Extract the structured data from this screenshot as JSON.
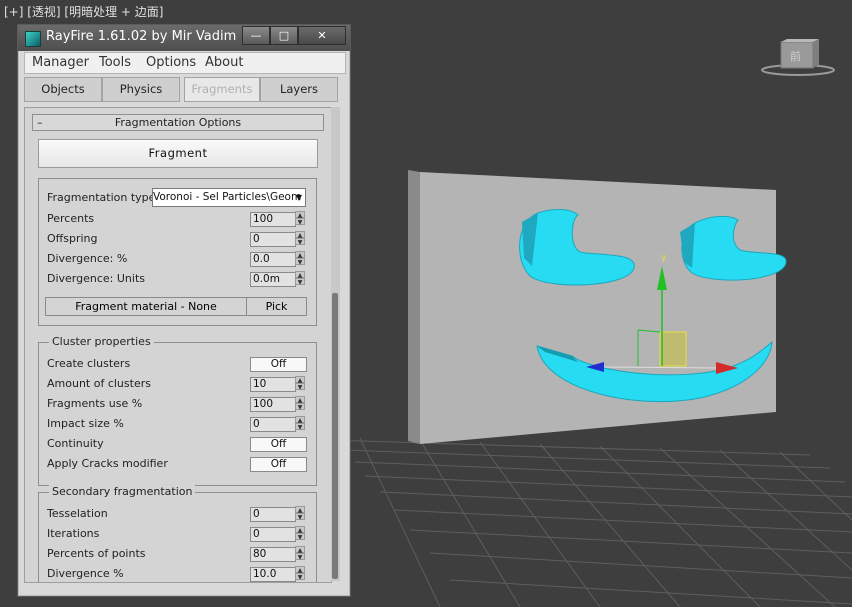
{
  "viewport": {
    "label": "[+] [透视] [明暗处理 + 边面]",
    "viewcube_label": "前"
  },
  "window": {
    "title": "RayFire 1.61.02  by Mir Vadim",
    "min_glyph": "—",
    "max_glyph": "□",
    "close_glyph": "✕"
  },
  "menu": [
    "Manager",
    "Tools",
    "Options",
    "About"
  ],
  "tabs": [
    {
      "label": "Objects",
      "active": false
    },
    {
      "label": "Physics",
      "active": false
    },
    {
      "label": "Fragments",
      "active": true
    },
    {
      "label": "Layers",
      "active": false
    }
  ],
  "rollout": {
    "minus": "–",
    "title": "Fragmentation Options",
    "fragment_button": "Fragment"
  },
  "frag_group": {
    "type_label": "Fragmentation type",
    "type_value": "Voronoi - Sel Particles\\Geom",
    "rows": [
      {
        "label": "Percents",
        "value": "100"
      },
      {
        "label": "Offspring",
        "value": "0"
      },
      {
        "label": "Divergence: %",
        "value": "0.0"
      },
      {
        "label": "Divergence: Units",
        "value": "0.0m"
      }
    ],
    "material_label": "Fragment material - None",
    "pick_label": "Pick"
  },
  "cluster_group": {
    "title": "Cluster properties",
    "create_label": "Create clusters",
    "create_value": "Off",
    "amount_label": "Amount of clusters",
    "amount_value": "10",
    "fraguse_label": "Fragments use %",
    "fraguse_value": "100",
    "impact_label": "Impact size %",
    "impact_value": "0",
    "continuity_label": "Continuity",
    "continuity_value": "Off",
    "cracks_label": "Apply Cracks modifier",
    "cracks_value": "Off"
  },
  "secondary_group": {
    "title": "Secondary fragmentation",
    "rows": [
      {
        "label": "Tesselation",
        "value": "0"
      },
      {
        "label": "Iterations",
        "value": "0"
      },
      {
        "label": "Percents of points",
        "value": "80"
      },
      {
        "label": "Divergence %",
        "value": "10.0"
      }
    ]
  },
  "colors": {
    "viewport_bg": "#3e3e3e",
    "wall": "#b4b4b4",
    "face": "#27dcf2",
    "panel": "#d4d4d4"
  }
}
